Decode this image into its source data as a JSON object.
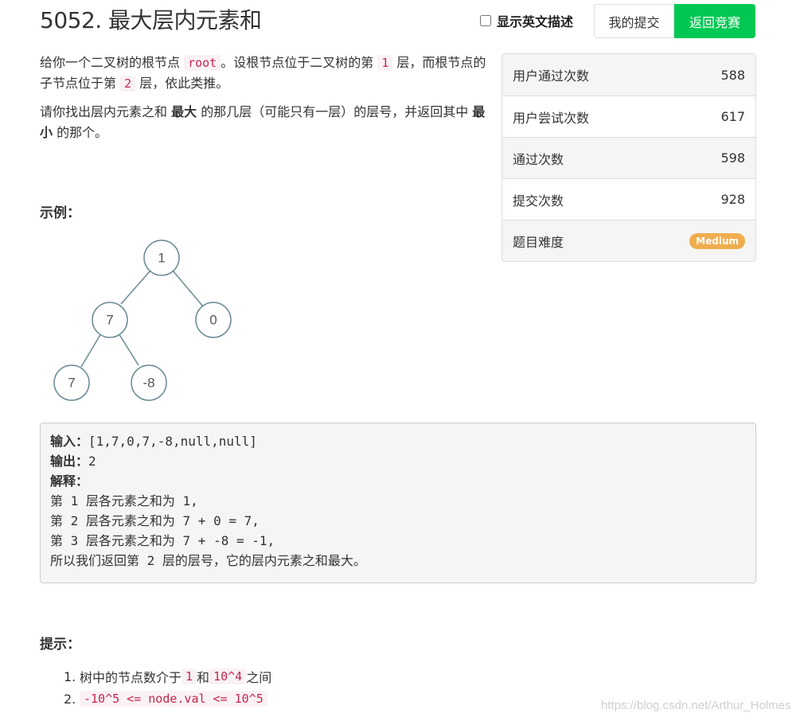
{
  "header": {
    "title": "5052. 最大层内元素和",
    "toggle_label": "显示英文描述",
    "my_submissions_label": "我的提交",
    "back_label": "返回竞赛"
  },
  "description": {
    "p1_a": "给你一个二叉树的根节点 ",
    "p1_code1": "root",
    "p1_b": "。设根节点位于二叉树的第 ",
    "p1_code2": "1",
    "p1_c": " 层，而根节点的子节点位于第 ",
    "p1_code3": "2",
    "p1_d": " 层，依此类推。",
    "p2_a": "请你找出层内元素之和 ",
    "p2_b1": "最大",
    "p2_c": " 的那几层（可能只有一层）的层号，并返回其中 ",
    "p2_b2": "最小",
    "p2_d": " 的那个。"
  },
  "example": {
    "heading": "示例：",
    "tree_nodes": [
      "1",
      "7",
      "0",
      "7",
      "-8"
    ],
    "input_label": "输入：",
    "input_value": "[1,7,0,7,-8,null,null]",
    "output_label": "输出：",
    "output_value": "2",
    "explain_label": "解释：",
    "explain_lines": [
      "第 1 层各元素之和为 1,",
      "第 2 层各元素之和为 7 + 0 = 7,",
      "第 3 层各元素之和为 7 + -8 = -1,",
      "所以我们返回第 2 层的层号，它的层内元素之和最大。"
    ]
  },
  "hints": {
    "heading": "提示：",
    "h1_num": "1.",
    "h1_a": "树中的节点数介于 ",
    "h1_code1": "1",
    "h1_b": " 和 ",
    "h1_code2": "10^4",
    "h1_c": " 之间",
    "h2_num": "2.",
    "h2_code": "-10^5 <= node.val <= 10^5"
  },
  "stats": {
    "rows": [
      {
        "label": "用户通过次数",
        "value": "588"
      },
      {
        "label": "用户尝试次数",
        "value": "617"
      },
      {
        "label": "通过次数",
        "value": "598"
      },
      {
        "label": "提交次数",
        "value": "928"
      }
    ],
    "difficulty_label": "题目难度",
    "difficulty_value": "Medium"
  },
  "watermark": "https://blog.csdn.net/Arthur_Holmes",
  "colors": {
    "accent_green": "#00c853",
    "badge_orange": "#f0ad4e",
    "code_red": "#c7254e"
  }
}
